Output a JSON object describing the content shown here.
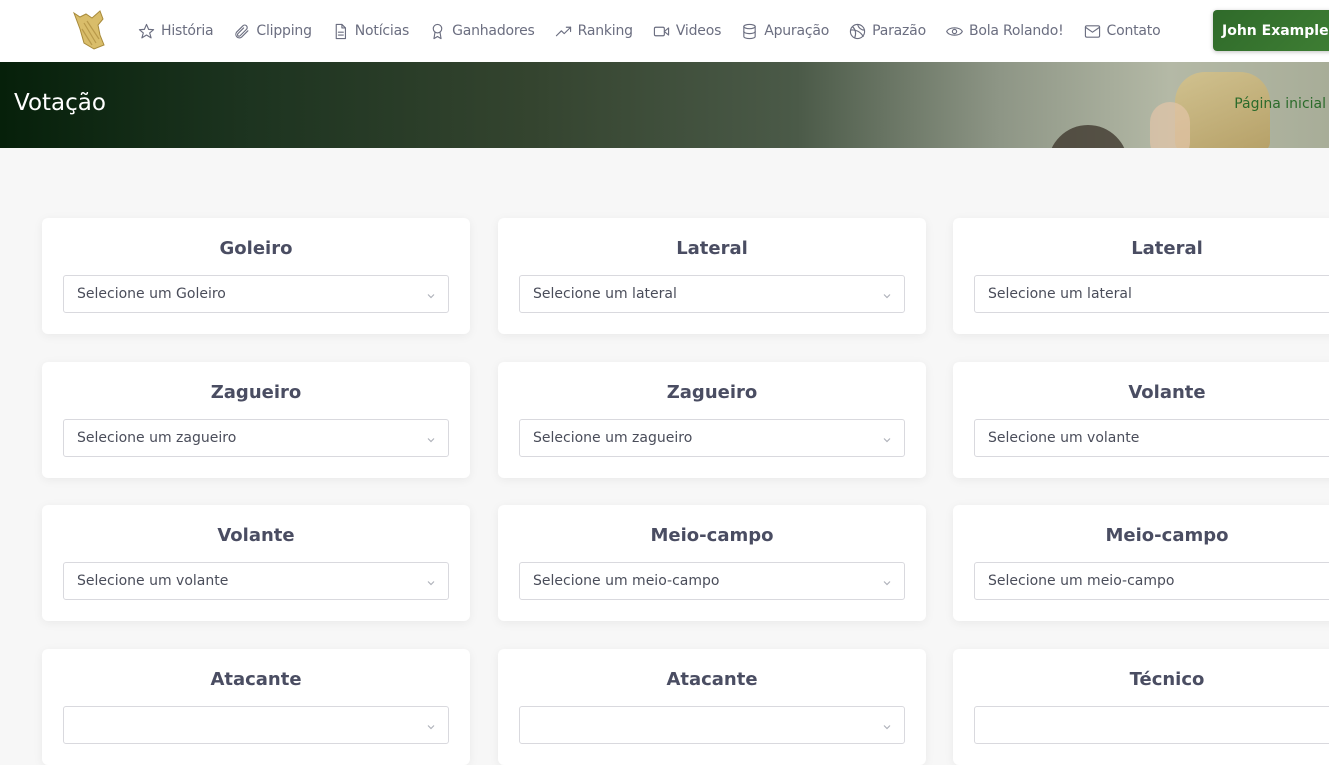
{
  "nav": {
    "logo_alt": "trophy-logo",
    "items": [
      {
        "label": "História",
        "icon": "star-icon"
      },
      {
        "label": "Clipping",
        "icon": "paperclip-icon"
      },
      {
        "label": "Notícias",
        "icon": "document-icon"
      },
      {
        "label": "Ganhadores",
        "icon": "award-icon"
      },
      {
        "label": "Ranking",
        "icon": "trending-up-icon"
      },
      {
        "label": "Videos",
        "icon": "video-icon"
      },
      {
        "label": "Apuração",
        "icon": "database-icon"
      },
      {
        "label": "Parazão",
        "icon": "ball-icon"
      },
      {
        "label": "Bola Rolando!",
        "icon": "eye-icon"
      },
      {
        "label": "Contato",
        "icon": "mail-icon"
      }
    ],
    "user_button": "John Example"
  },
  "hero": {
    "title": "Votação",
    "breadcrumb": "Página inicial"
  },
  "colors": {
    "accent_green": "#3f7f34",
    "breadcrumb_green": "#2b6b2b",
    "card_title": "#4a4d62"
  },
  "cards": [
    {
      "title": "Goleiro",
      "placeholder": "Selecione um Goleiro"
    },
    {
      "title": "Lateral",
      "placeholder": "Selecione um lateral"
    },
    {
      "title": "Lateral",
      "placeholder": "Selecione um lateral"
    },
    {
      "title": "Zagueiro",
      "placeholder": "Selecione um zagueiro"
    },
    {
      "title": "Zagueiro",
      "placeholder": "Selecione um zagueiro"
    },
    {
      "title": "Volante",
      "placeholder": "Selecione um volante"
    },
    {
      "title": "Volante",
      "placeholder": "Selecione um volante"
    },
    {
      "title": "Meio-campo",
      "placeholder": "Selecione um meio-campo"
    },
    {
      "title": "Meio-campo",
      "placeholder": "Selecione um meio-campo"
    },
    {
      "title": "Atacante",
      "placeholder": ""
    },
    {
      "title": "Atacante",
      "placeholder": ""
    },
    {
      "title": "Técnico",
      "placeholder": ""
    }
  ]
}
